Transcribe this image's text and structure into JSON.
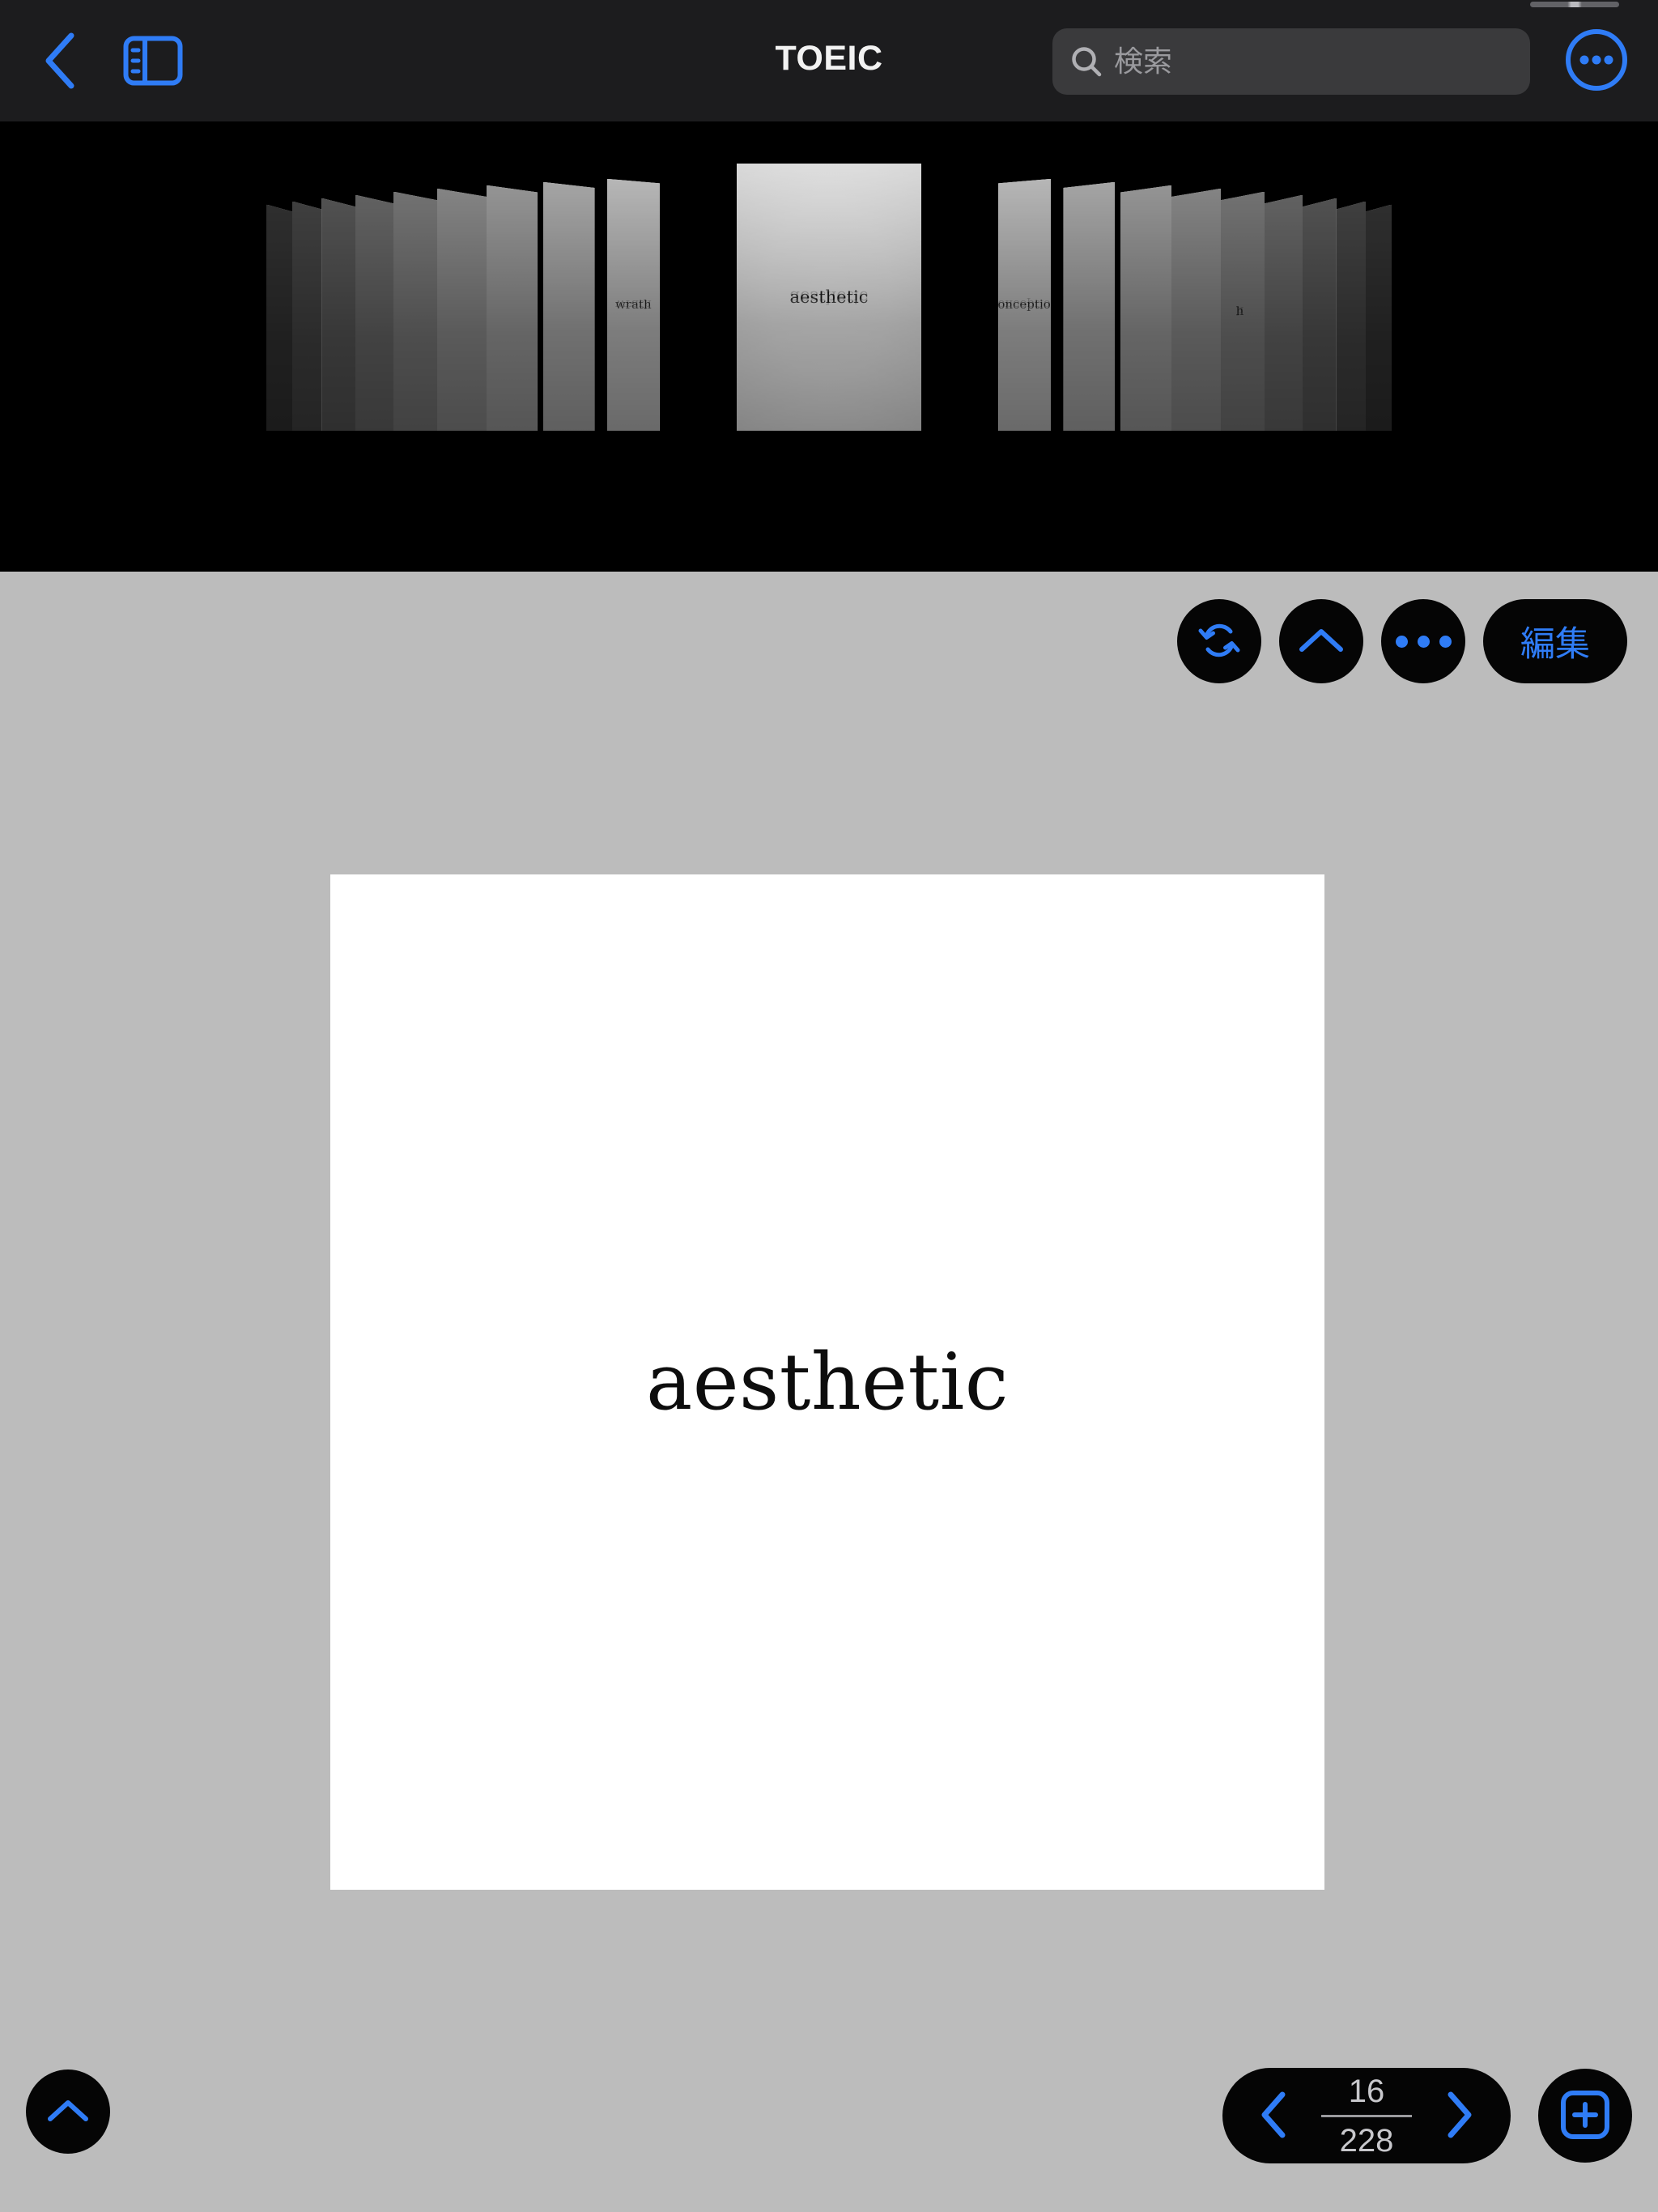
{
  "accent": "#2f7cf6",
  "background": "#bcbcbc",
  "chrome_bg": "#1c1c1e",
  "button_bg": "#050505",
  "statusbar": {
    "indicator": "battery-indicator"
  },
  "navbar": {
    "back_icon": "chevron-left-icon",
    "sidebar_icon": "sidebar-toggle-icon",
    "title": "TOEIC",
    "search": {
      "icon": "search-icon",
      "placeholder": "検索",
      "value": ""
    },
    "more_icon": "ellipsis-circle-icon"
  },
  "carousel": {
    "center_index": 9,
    "cards": [
      {
        "word": "",
        "depth": 9
      },
      {
        "word": "",
        "depth": 8
      },
      {
        "word": "",
        "depth": 7
      },
      {
        "word": "",
        "depth": 6
      },
      {
        "word": "",
        "depth": 5
      },
      {
        "word": "",
        "depth": 4
      },
      {
        "word": "",
        "depth": 3
      },
      {
        "word": "",
        "depth": 2
      },
      {
        "word": "wrath",
        "depth": 1
      },
      {
        "word": "aesthetic",
        "depth": 0
      },
      {
        "word": "conception",
        "depth": 1
      },
      {
        "word": "",
        "depth": 2
      },
      {
        "word": "",
        "depth": 3
      },
      {
        "word": "",
        "depth": 4
      },
      {
        "word": "h",
        "depth": 5
      },
      {
        "word": "",
        "depth": 6
      },
      {
        "word": "",
        "depth": 7
      },
      {
        "word": "",
        "depth": 8
      },
      {
        "word": "",
        "depth": 9
      }
    ]
  },
  "toolbar": {
    "shuffle_icon": "refresh-circular-arrows-icon",
    "collapse_icon": "chevron-up-icon",
    "more_icon": "ellipsis-icon",
    "edit_label": "編集"
  },
  "main_card": {
    "word": "aesthetic"
  },
  "bottom": {
    "expand_icon": "chevron-up-icon",
    "prev_icon": "chevron-left-icon",
    "next_icon": "chevron-right-icon",
    "current_page": "16",
    "total_pages": "228",
    "add_icon": "plus-square-icon"
  }
}
